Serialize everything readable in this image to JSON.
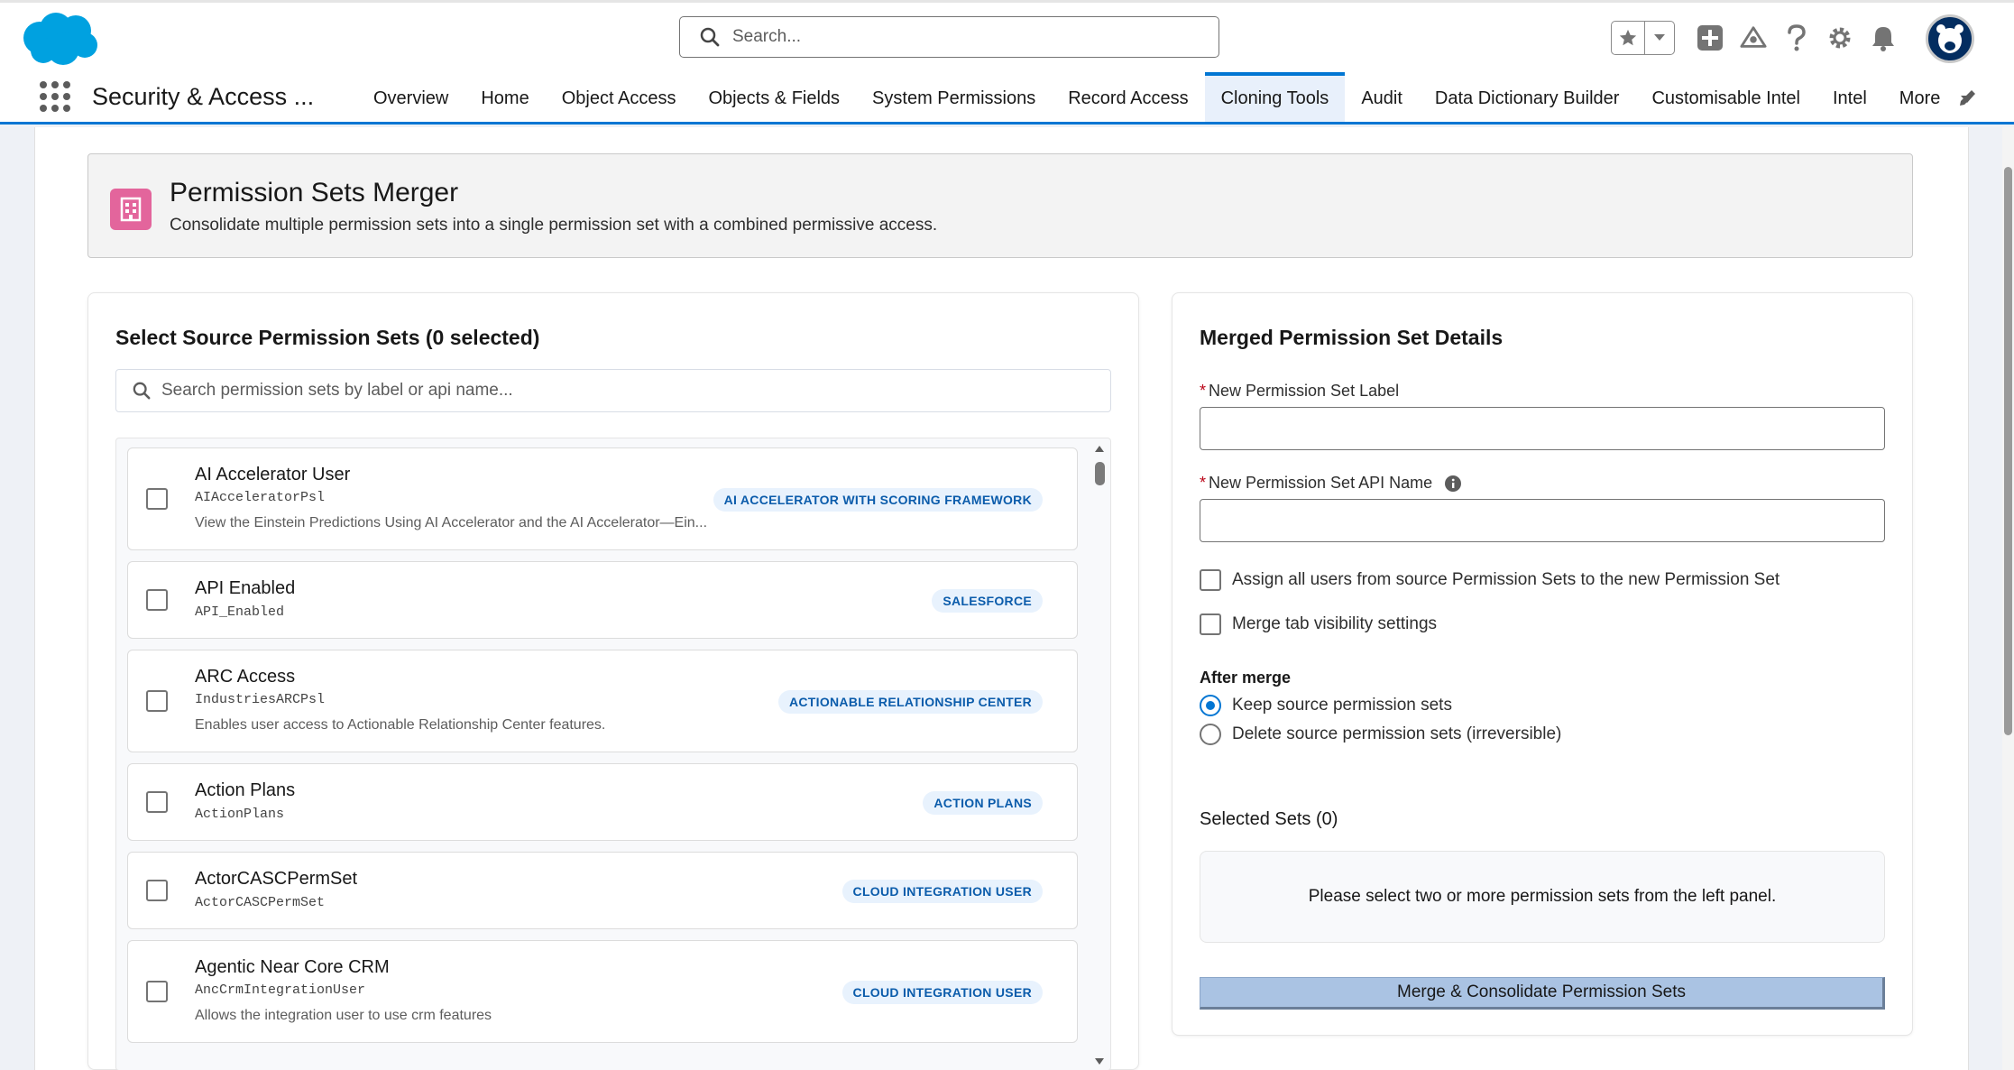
{
  "header": {
    "search_placeholder": "Search...",
    "icons": [
      "salesforce-cloud-logo",
      "search-icon",
      "star-icon",
      "chevron-down-icon",
      "plus-icon",
      "trailhead-icon",
      "help-icon",
      "gear-icon",
      "bell-icon",
      "avatar-icon"
    ]
  },
  "nav": {
    "app_name": "Security & Access ...",
    "tabs": [
      {
        "label": "Overview",
        "active": false
      },
      {
        "label": "Home",
        "active": false
      },
      {
        "label": "Object Access",
        "active": false
      },
      {
        "label": "Objects & Fields",
        "active": false
      },
      {
        "label": "System Permissions",
        "active": false
      },
      {
        "label": "Record Access",
        "active": false
      },
      {
        "label": "Cloning Tools",
        "active": true
      },
      {
        "label": "Audit",
        "active": false
      },
      {
        "label": "Data Dictionary Builder",
        "active": false
      },
      {
        "label": "Customisable Intel",
        "active": false
      },
      {
        "label": "Intel",
        "active": false
      },
      {
        "label": "More",
        "active": false
      }
    ]
  },
  "page_header": {
    "title": "Permission Sets Merger",
    "subtitle": "Consolidate multiple permission sets into a single permission set with a combined permissive access."
  },
  "source": {
    "title": "Select Source Permission Sets (0 selected)",
    "search_placeholder": "Search permission sets by label or api name...",
    "items": [
      {
        "label": "AI Accelerator User",
        "api": "AIAcceleratorPsl",
        "badge": "AI ACCELERATOR WITH SCORING FRAMEWORK",
        "desc": "View the Einstein Predictions Using AI Accelerator and the AI Accelerator—Ein..."
      },
      {
        "label": "API Enabled",
        "api": "API_Enabled",
        "badge": "SALESFORCE",
        "desc": ""
      },
      {
        "label": "ARC Access",
        "api": "IndustriesARCPsl",
        "badge": "ACTIONABLE RELATIONSHIP CENTER",
        "desc": "Enables user access to Actionable Relationship Center features."
      },
      {
        "label": "Action Plans",
        "api": "ActionPlans",
        "badge": "ACTION PLANS",
        "desc": ""
      },
      {
        "label": "ActorCASCPermSet",
        "api": "ActorCASCPermSet",
        "badge": "CLOUD INTEGRATION USER",
        "desc": ""
      },
      {
        "label": "Agentic Near Core CRM",
        "api": "AncCrmIntegrationUser",
        "badge": "CLOUD INTEGRATION USER",
        "desc": "Allows the integration user to use crm features"
      }
    ]
  },
  "merged": {
    "title": "Merged Permission Set Details",
    "label_field": "New Permission Set Label",
    "api_field": "New Permission Set API Name",
    "required_mark": "*",
    "assign_users": "Assign all users from source Permission Sets to the new Permission Set",
    "merge_tabs": "Merge tab visibility settings",
    "after_merge": "After merge",
    "keep_option": "Keep source permission sets",
    "delete_option": "Delete source permission sets (irreversible)",
    "selected_title": "Selected Sets (0)",
    "selected_empty": "Please select two or more permission sets from the left panel.",
    "merge_button": "Merge & Consolidate Permission Sets"
  },
  "colors": {
    "brand": "#0176d3",
    "header_icon": "#e3659c",
    "badge_bg": "#e8f2fd",
    "badge_text": "#0b5cab",
    "button_disabled": "#aac3e3"
  }
}
